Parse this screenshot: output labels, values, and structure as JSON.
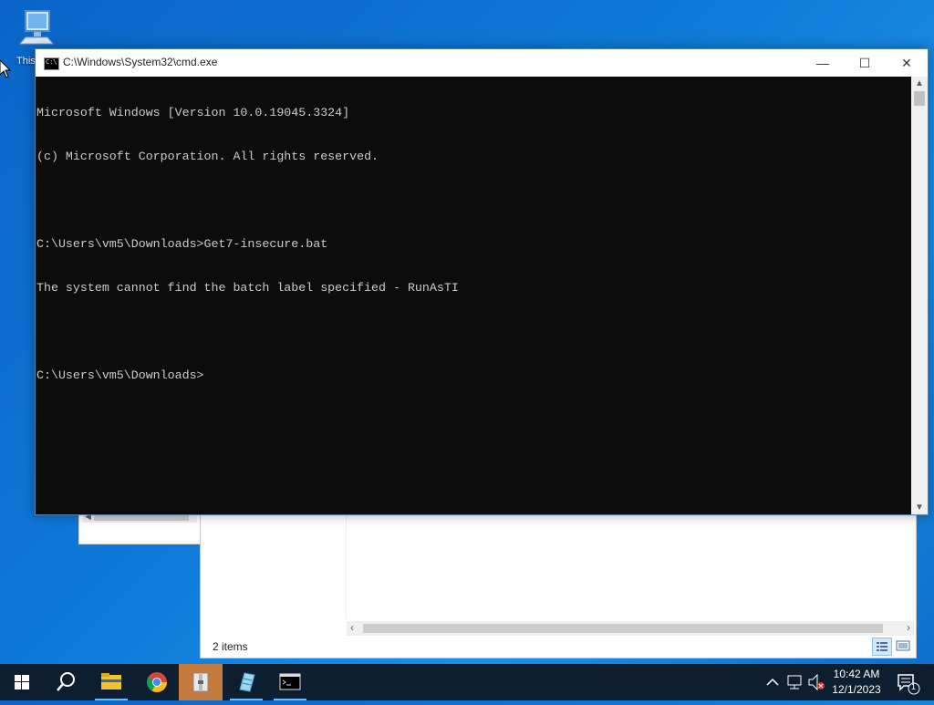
{
  "desktop": {
    "icon_label": "This PC"
  },
  "cmd_window": {
    "title": "C:\\Windows\\System32\\cmd.exe",
    "console_lines": [
      "Microsoft Windows [Version 10.0.19045.3324]",
      "(c) Microsoft Corporation. All rights reserved.",
      "",
      "C:\\Users\\vm5\\Downloads>Get7-insecure.bat",
      "The system cannot find the batch label specified - RunAsTI",
      "",
      "C:\\Users\\vm5\\Downloads>"
    ],
    "controls": {
      "minimize": "—",
      "maximize": "☐",
      "close": "✕"
    }
  },
  "explorer_window": {
    "status_text": "2 items"
  },
  "taskbar": {
    "items": [
      {
        "icon": "windows-start-icon"
      },
      {
        "icon": "search-icon"
      },
      {
        "icon": "file-explorer-icon"
      },
      {
        "icon": "chrome-icon"
      },
      {
        "icon": "archive-app-icon",
        "active": true
      },
      {
        "icon": "notepad-app-icon"
      },
      {
        "icon": "cmd-icon"
      }
    ],
    "clock": {
      "time": "10:42 AM",
      "date": "12/1/2023"
    },
    "notification_count": "1"
  }
}
